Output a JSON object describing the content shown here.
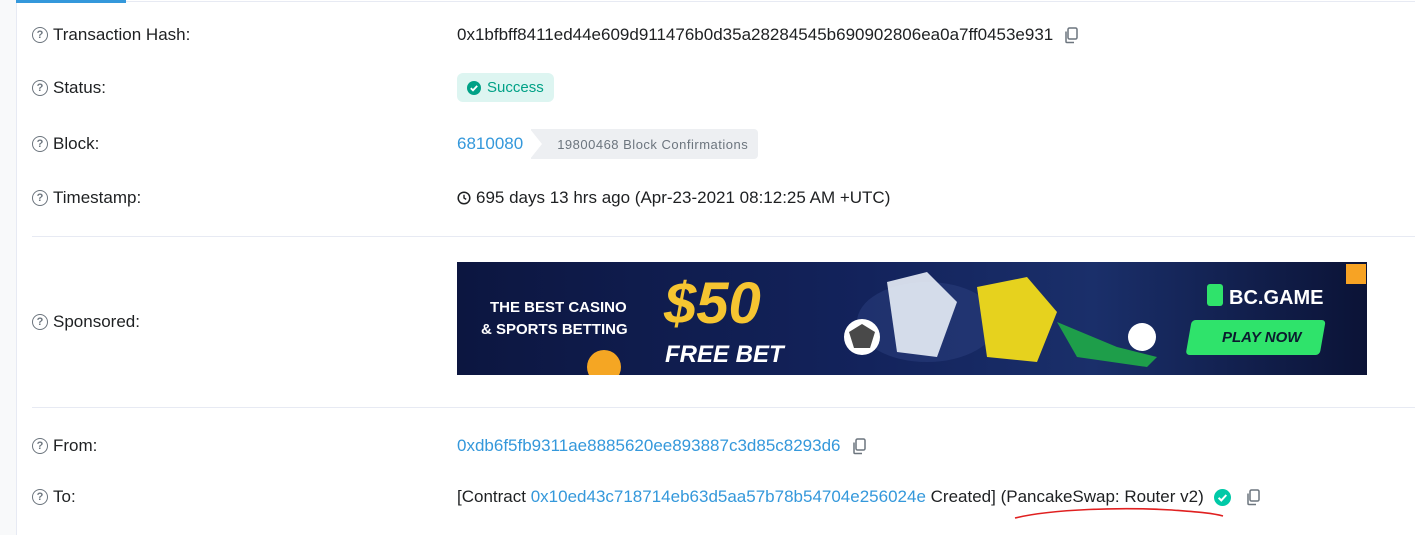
{
  "labels": {
    "tx_hash": "Transaction Hash:",
    "status": "Status:",
    "block": "Block:",
    "timestamp": "Timestamp:",
    "sponsored": "Sponsored:",
    "from": "From:",
    "to": "To:"
  },
  "values": {
    "tx_hash": "0x1bfbff8411ed44e609d911476b0d35a28284545b690902806ea0a7ff0453e931",
    "status": "Success",
    "block_number": "6810080",
    "block_confirmations": "19800468 Block Confirmations",
    "timestamp": "695 days 13 hrs ago (Apr-23-2021 08:12:25 AM +UTC)",
    "from_address": "0xdb6f5fb9311ae8885620ee893887c3d85c8293d6",
    "to_prefix": "[Contract",
    "to_contract": "0x10ed43c718714eb63d5aa57b78b54704e256024e",
    "to_suffix": "Created]",
    "to_name": "(PancakeSwap: Router v2)"
  },
  "ad": {
    "line1": "THE BEST CASINO",
    "line2": "& SPORTS BETTING",
    "amount": "$50",
    "free_bet": "FREE BET",
    "brand": "BC.GAME",
    "cta": "PLAY NOW"
  },
  "colors": {
    "link": "#3498db",
    "success_bg": "#ddf5f1",
    "success_text": "#00a186",
    "annotation": "#e02020"
  }
}
